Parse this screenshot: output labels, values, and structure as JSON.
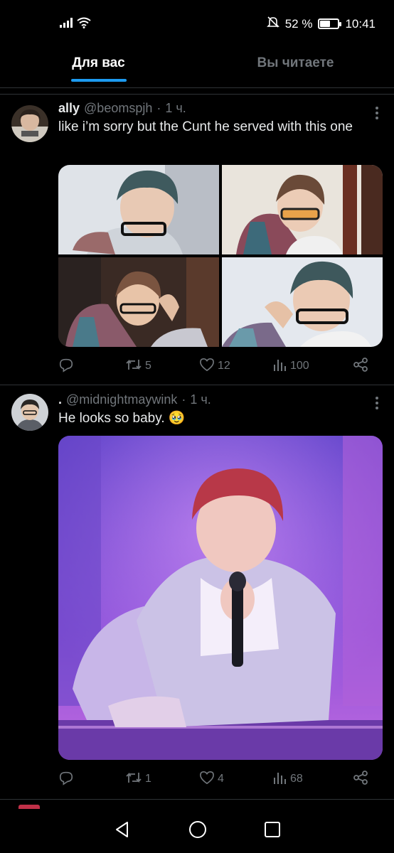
{
  "status_bar": {
    "battery": "52 %",
    "battery_level": 0.52,
    "time": "10:41"
  },
  "tabs": [
    {
      "label": "Для вас",
      "active": true
    },
    {
      "label": "Вы читаете",
      "active": false
    }
  ],
  "tweets": [
    {
      "name": "ally",
      "handle": "@beomspjh",
      "dot": "·",
      "time": "1 ч.",
      "text": "like i’m sorry but the Cunt he served with this one",
      "replies": "",
      "retweets": "5",
      "likes": "12",
      "views": "100"
    },
    {
      "name": ".",
      "handle": "@midnightmaywink",
      "dot": "·",
      "time": "1 ч.",
      "text": "He looks so baby. 🥹",
      "replies": "",
      "retweets": "1",
      "likes": "4",
      "views": "68"
    }
  ],
  "colors": {
    "accent": "#1d9bf0",
    "muted": "#71767b",
    "divider": "#2f3336",
    "background": "#000000"
  },
  "icons": [
    "signal-icon",
    "wifi-icon",
    "mute-icon",
    "battery-icon",
    "more-icon",
    "reply-icon",
    "retweet-icon",
    "like-icon",
    "views-icon",
    "share-icon",
    "back-icon",
    "home-icon",
    "recents-icon"
  ]
}
